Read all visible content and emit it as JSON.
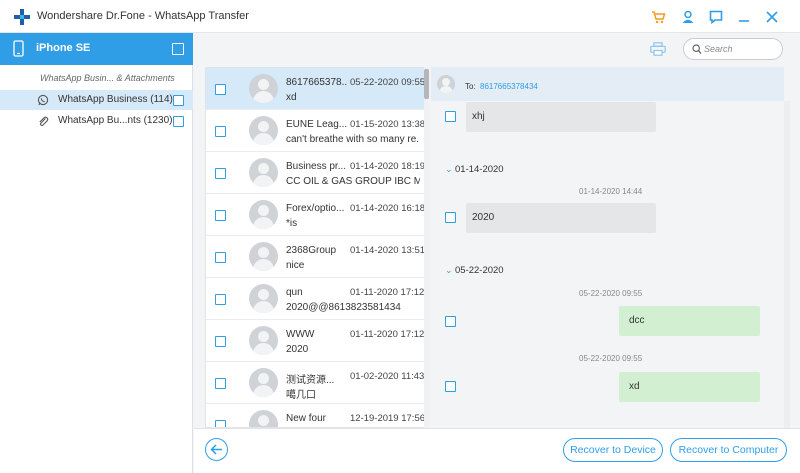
{
  "app": {
    "title": "Wondershare Dr.Fone - WhatsApp Transfer",
    "accent": "#2f9ee7"
  },
  "sidebar": {
    "device": "iPhone SE",
    "section": "WhatsApp Busin... & Attachments",
    "items": [
      {
        "label": "WhatsApp Business (114)",
        "icon": "whatsapp-icon",
        "active": true
      },
      {
        "label": "WhatsApp Bu...nts (1230)",
        "icon": "paperclip-icon",
        "active": false
      }
    ]
  },
  "search": {
    "placeholder": "Search"
  },
  "chats": [
    {
      "name": "8617665378...",
      "time": "05-22-2020 09:55",
      "preview": "xd",
      "active": true
    },
    {
      "name": "EUNE Leag...",
      "time": "01-15-2020 13:38",
      "preview": "can't breathe with so many re..."
    },
    {
      "name": "Business pr...",
      "time": "01-14-2020 18:19",
      "preview": "CC OIL & GAS GROUP IBC MO..."
    },
    {
      "name": "Forex/optio...",
      "time": "01-14-2020 16:18",
      "preview": "*is"
    },
    {
      "name": "2368Group",
      "time": "01-14-2020 13:51",
      "preview": "nice"
    },
    {
      "name": "qun",
      "time": "01-11-2020 17:12",
      "preview": "2020@@8613823581434"
    },
    {
      "name": "WWW",
      "time": "01-11-2020 17:12",
      "preview": "2020"
    },
    {
      "name": "测试资源...",
      "time": "01-02-2020 11:43",
      "preview": "噶几口"
    },
    {
      "name": "New four",
      "time": "12-19-2019 17:56",
      "preview": ""
    }
  ],
  "conversation": {
    "to_label": "To:",
    "to_number": "8617665378434",
    "messages": {
      "m1": {
        "text": "xhj"
      },
      "sep1": "01-14-2020",
      "t2": "01-14-2020 14:44",
      "m2": {
        "text": "2020"
      },
      "sep2": "05-22-2020",
      "t3": "05-22-2020 09:55",
      "m3": {
        "text": "dcc"
      },
      "t4": "05-22-2020 09:55",
      "m4": {
        "text": "xd"
      }
    }
  },
  "buttons": {
    "recover_device": "Recover to Device",
    "recover_computer": "Recover to Computer"
  }
}
